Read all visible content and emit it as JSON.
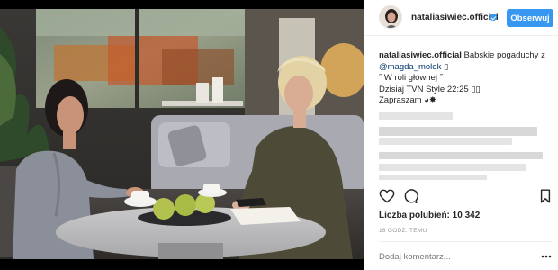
{
  "post": {
    "username": "nataliasiwiec.official",
    "follow_label": "Obserwuj",
    "caption": {
      "username": "nataliasiwiec.official",
      "line1_text": "Babskie pogaduchy z",
      "mention": "@magda_molek",
      "mention_suffix": " ▯",
      "line3": "˝ W roli głównej ˝",
      "line4": "Dzisiaj TVN Style 22:25 ▯▯",
      "line5": "Zapraszam ◕✸"
    },
    "likes_text": "Liczba polubień: 10 342",
    "timestamp": "16 GODZ. TEMU",
    "comment_placeholder": "Dodaj komentarz..."
  },
  "icons": {
    "verified": "verified-badge-icon",
    "like": "heart-icon",
    "comment": "comment-bubble-icon",
    "save": "bookmark-icon",
    "more": "more-options-icon"
  },
  "colors": {
    "accent": "#3897f0",
    "mention": "#003569",
    "muted": "#999999"
  }
}
